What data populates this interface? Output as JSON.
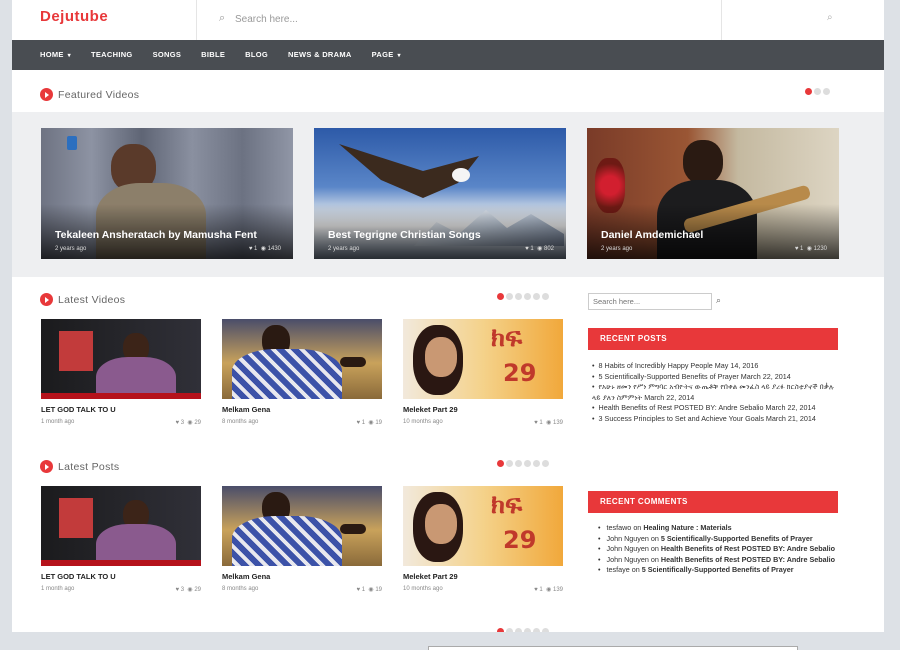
{
  "brand": {
    "logo": "Dejutube",
    "accent": "#e8383a"
  },
  "header": {
    "search_placeholder": "Search here...",
    "search_icon": "search-icon"
  },
  "nav": {
    "items": [
      {
        "label": "HOME",
        "has_caret": true
      },
      {
        "label": "TEACHING"
      },
      {
        "label": "SONGS"
      },
      {
        "label": "BIBLE"
      },
      {
        "label": "BLOG"
      },
      {
        "label": "NEWS & DRAMA"
      },
      {
        "label": "PAGE",
        "has_caret": true
      }
    ]
  },
  "featured": {
    "heading": "Featured Videos",
    "items": [
      {
        "title": "Tekaleen Ansheratach by Mamusha Fent",
        "age": "2 years ago",
        "likes": "1",
        "views": "1430"
      },
      {
        "title": "Best Tegrigne Christian Songs",
        "age": "2 years ago",
        "likes": "1",
        "views": "802"
      },
      {
        "title": "Daniel Amdemichael",
        "age": "2 years ago",
        "likes": "1",
        "views": "1230"
      }
    ]
  },
  "latest_videos": {
    "heading": "Latest Videos",
    "items": [
      {
        "title": "LET GOD TALK TO U",
        "age": "1 month ago",
        "likes": "3",
        "views": "29"
      },
      {
        "title": "Melkam Gena",
        "age": "8 months ago",
        "likes": "1",
        "views": "19"
      },
      {
        "title": "Meleket Part 29",
        "age": "10 months ago",
        "likes": "1",
        "views": "139"
      }
    ]
  },
  "latest_posts": {
    "heading": "Latest Posts",
    "items": [
      {
        "title": "LET GOD TALK TO U",
        "age": "1 month ago",
        "likes": "3",
        "views": "29"
      },
      {
        "title": "Melkam Gena",
        "age": "8 months ago",
        "likes": "1",
        "views": "19"
      },
      {
        "title": "Meleket Part 29",
        "age": "10 months ago",
        "likes": "1",
        "views": "139"
      }
    ]
  },
  "sidebar": {
    "search_placeholder": "Search here...",
    "recent_posts": {
      "title": "RECENT POSTS",
      "items": [
        "8 Habits of Incredibly Happy People May 14, 2016",
        "5 Scientifically-Supported Benefits of Prayer March 22, 2014",
        "የአሁኑ ዘመን የሥነ ምግባር አብዮትና ውጤቶቹ የበቀል መንፈስ ላይ ያረፉ ክርስቲያኖች በቃሉ ላይ ያለን ስምምነት March 22, 2014",
        "Health Benefits of Rest POSTED BY: Andre Sebalio March 22, 2014",
        "3 Success Principles to Set and Achieve Your Goals March 21, 2014"
      ]
    },
    "recent_comments": {
      "title": "RECENT COMMENTS",
      "items": [
        {
          "author": "tesfawo",
          "on": "on",
          "post": "Healing Nature : Materials"
        },
        {
          "author": "John Nguyen",
          "on": "on",
          "post": "5 Scientifically-Supported Benefits of Prayer"
        },
        {
          "author": "John Nguyen",
          "on": "on",
          "post": "Health Benefits of Rest POSTED BY: Andre Sebalio"
        },
        {
          "author": "John Nguyen",
          "on": "on",
          "post": "Health Benefits of Rest POSTED BY: Andre Sebalio"
        },
        {
          "author": "tesfaye",
          "on": "on",
          "post": "5 Scientifically-Supported Benefits of Prayer"
        }
      ]
    }
  }
}
